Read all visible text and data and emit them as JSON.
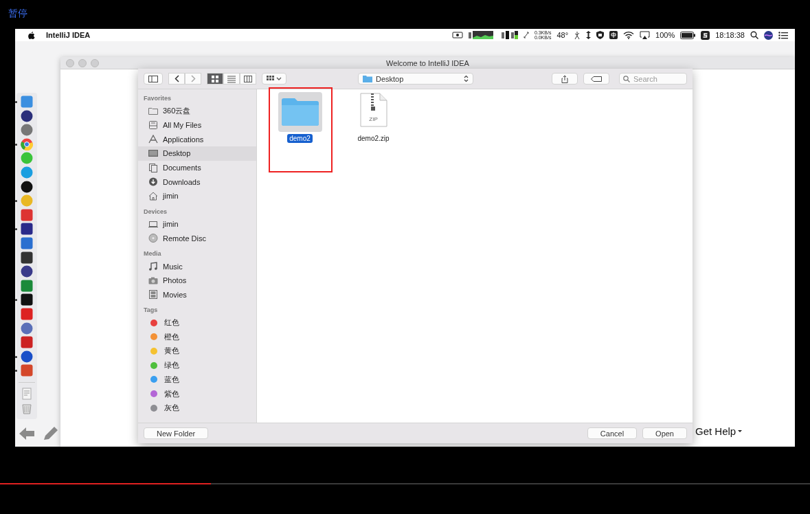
{
  "player": {
    "status": "暂停",
    "progress": {
      "level": 0.26
    }
  },
  "menu_bar": {
    "app": "IntelliJ IDEA",
    "net_up": "0.3KB/s",
    "net_down": "0.0KB/s",
    "temperature": "48°",
    "battery": "100%",
    "clock": "18:18:38"
  },
  "dock": {
    "items": [
      {
        "running": true
      },
      {
        "running": false
      },
      {
        "running": false
      },
      {
        "running": true
      },
      {
        "running": false
      },
      {
        "running": false
      },
      {
        "running": false
      },
      {
        "running": true
      },
      {
        "running": false
      },
      {
        "running": true
      },
      {
        "running": false
      },
      {
        "running": false
      },
      {
        "running": false
      },
      {
        "running": false
      },
      {
        "running": true
      },
      {
        "running": false
      },
      {
        "running": false
      },
      {
        "running": false
      },
      {
        "running": true
      },
      {
        "running": true
      }
    ]
  },
  "window": {
    "title": "Welcome to IntelliJ IDEA",
    "help": "Get Help"
  },
  "dialog": {
    "view_modes": [
      {
        "kind": "icons",
        "selected": true
      },
      {
        "kind": "list",
        "selected": false
      },
      {
        "kind": "columns",
        "selected": false
      }
    ],
    "location": "Desktop",
    "search": {
      "placeholder": "Search"
    },
    "sidebar": [
      {
        "heading": "Favorites",
        "items": [
          {
            "label": "360云盘",
            "selected": false
          },
          {
            "label": "All My Files",
            "selected": false
          },
          {
            "label": "Applications",
            "selected": false
          },
          {
            "label": "Desktop",
            "selected": true
          },
          {
            "label": "Documents",
            "selected": false
          },
          {
            "label": "Downloads",
            "selected": false
          },
          {
            "label": "jimin",
            "selected": false
          }
        ]
      },
      {
        "heading": "Devices",
        "items": [
          {
            "label": "jimin",
            "selected": false
          },
          {
            "label": "Remote Disc",
            "selected": false
          }
        ]
      },
      {
        "heading": "Media",
        "items": [
          {
            "label": "Music",
            "selected": false
          },
          {
            "label": "Photos",
            "selected": false
          },
          {
            "label": "Movies",
            "selected": false
          }
        ]
      },
      {
        "heading": "Tags",
        "items": [
          {
            "label": "红色",
            "color": "#e8413f",
            "selected": false
          },
          {
            "label": "橙色",
            "color": "#f39136",
            "selected": false
          },
          {
            "label": "黄色",
            "color": "#f5c231",
            "selected": false
          },
          {
            "label": "绿色",
            "color": "#4fbf3d",
            "selected": false
          },
          {
            "label": "蓝色",
            "color": "#3a9ff0",
            "selected": false
          },
          {
            "label": "紫色",
            "color": "#b366d6",
            "selected": false
          },
          {
            "label": "灰色",
            "color": "#8e8e93",
            "selected": false
          }
        ]
      }
    ],
    "files": [
      {
        "name": "demo2",
        "kind": "folder",
        "selected": true,
        "highlighted": true
      },
      {
        "name": "demo2.zip",
        "kind": "zip",
        "badge": "ZIP",
        "selected": false,
        "highlighted": false
      }
    ],
    "buttons": {
      "new_folder": "New Folder",
      "cancel": "Cancel",
      "open": "Open"
    }
  }
}
